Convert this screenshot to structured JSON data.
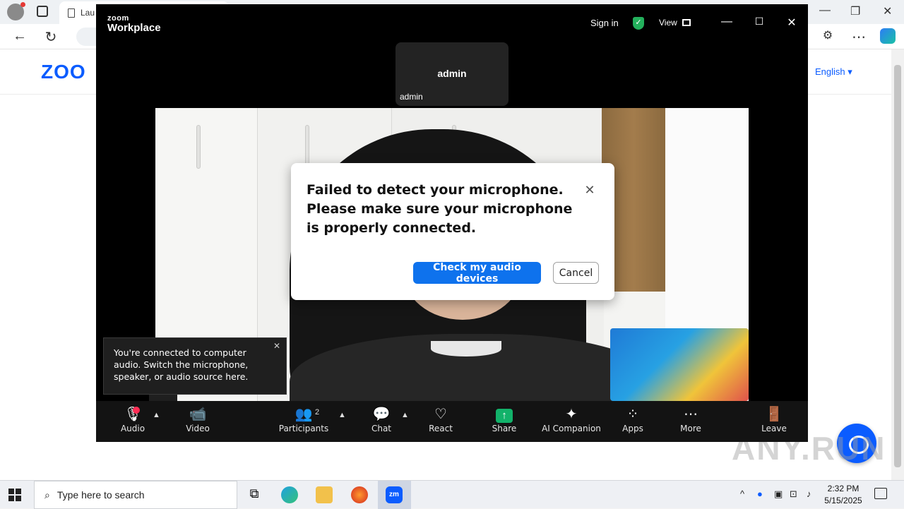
{
  "browser": {
    "tab_title": "Lau",
    "brand": "ZOO",
    "language": "English"
  },
  "zoom": {
    "brand_small": "zoom",
    "brand_big": "Workplace",
    "sign_in": "Sign in",
    "view": "View",
    "participant_name": "admin",
    "participant_label": "admin",
    "dialog": {
      "message": "Failed to detect your microphone. Please make sure your microphone is properly connected.",
      "primary_button": "Check my audio devices",
      "secondary_button": "Cancel"
    },
    "toast": {
      "message": "You're connected to computer audio. Switch the microphone, speaker, or audio source here."
    },
    "toolbar": {
      "audio": "Audio",
      "video": "Video",
      "participants": "Participants",
      "participants_count": "2",
      "chat": "Chat",
      "react": "React",
      "share": "Share",
      "ai_companion": "AI Companion",
      "apps": "Apps",
      "more": "More",
      "leave": "Leave"
    }
  },
  "taskbar": {
    "search_placeholder": "Type here to search",
    "time": "2:32 PM",
    "date": "5/15/2025"
  },
  "watermark": "ANY.RUN",
  "colors": {
    "zoom_blue": "#0b5cff",
    "primary_button": "#0e72ed",
    "share_green": "#12b26a",
    "mic_alert": "#ff2d55"
  }
}
